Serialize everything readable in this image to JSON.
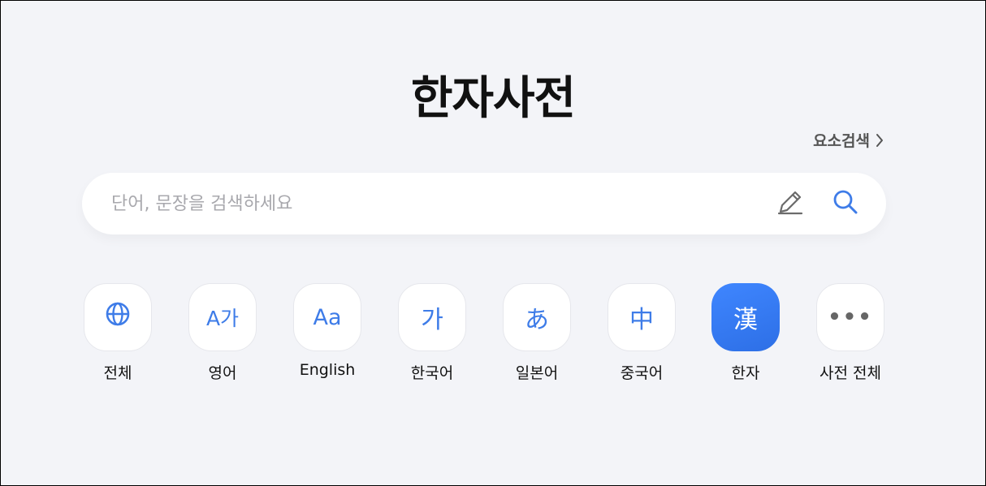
{
  "header": {
    "title": "한자사전",
    "element_search_label": "요소검색"
  },
  "search": {
    "placeholder": "단어, 문장을 검색하세요",
    "value": ""
  },
  "categories": [
    {
      "label": "전체",
      "icon": "globe-icon",
      "glyph": ""
    },
    {
      "label": "영어",
      "icon": "english-korean-icon",
      "glyph": "A가"
    },
    {
      "label": "English",
      "icon": "english-icon",
      "glyph": "Aa"
    },
    {
      "label": "한국어",
      "icon": "korean-icon",
      "glyph": "가"
    },
    {
      "label": "일본어",
      "icon": "japanese-icon",
      "glyph": "あ"
    },
    {
      "label": "중국어",
      "icon": "chinese-icon",
      "glyph": "中"
    },
    {
      "label": "한자",
      "icon": "hanja-icon",
      "glyph": "漢",
      "active": true
    },
    {
      "label": "사전 전체",
      "icon": "more-icon",
      "glyph": "•••"
    }
  ],
  "colors": {
    "accent": "#3e7ce8",
    "active_tile": "#2d6fe6",
    "background": "#f3f4f8"
  }
}
